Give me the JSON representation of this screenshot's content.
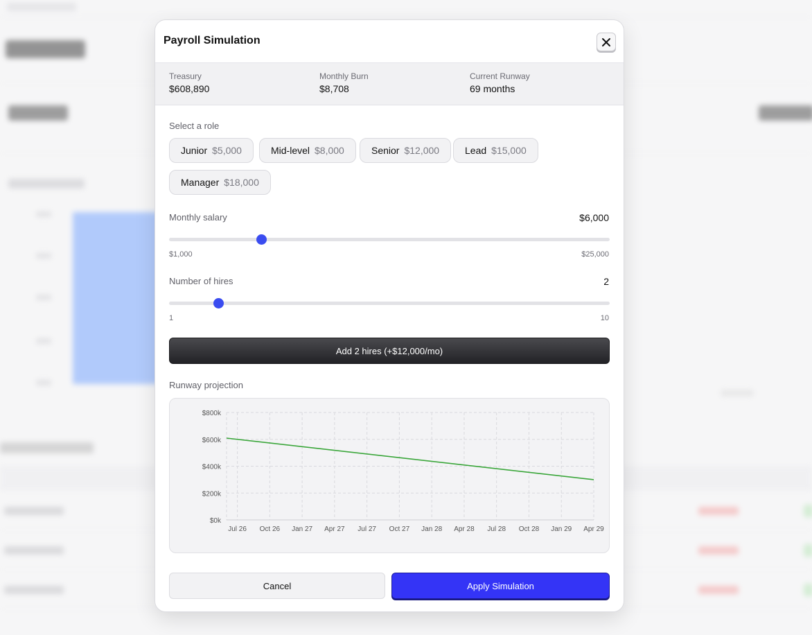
{
  "modal": {
    "title": "Payroll Simulation",
    "close_icon": "close-icon"
  },
  "summary": {
    "treasury_label": "Treasury",
    "treasury_value": "$608,890",
    "burn_label": "Monthly Burn",
    "burn_value": "$8,708",
    "runway_label": "Current Runway",
    "runway_value": "69 months"
  },
  "roles": {
    "label": "Select a role",
    "items": [
      {
        "name": "Junior",
        "salary": "$5,000"
      },
      {
        "name": "Mid-level",
        "salary": "$8,000"
      },
      {
        "name": "Senior",
        "salary": "$12,000"
      },
      {
        "name": "Lead",
        "salary": "$15,000"
      },
      {
        "name": "Manager",
        "salary": "$18,000"
      }
    ]
  },
  "salary": {
    "label": "Monthly salary",
    "value_text": "$6,000",
    "value": 6000,
    "min": 1000,
    "max": 25000,
    "min_label": "$1,000",
    "max_label": "$25,000"
  },
  "hires": {
    "label": "Number of hires",
    "value_text": "2",
    "value": 2,
    "min": 1,
    "max": 10,
    "min_label": "1",
    "max_label": "10"
  },
  "add_button": "Add 2 hires (+$12,000/mo)",
  "projection_label": "Runway projection",
  "chart_data": {
    "type": "line",
    "title": "",
    "xlabel": "",
    "ylabel": "",
    "ylim": [
      0,
      800000
    ],
    "yticks": [
      0,
      200000,
      400000,
      600000,
      800000
    ],
    "ytick_labels": [
      "$0k",
      "$200k",
      "$400k",
      "$600k",
      "$800k"
    ],
    "xtick_labels": [
      "Jul 26",
      "Oct 26",
      "Jan 27",
      "Apr 27",
      "Jul 27",
      "Oct 27",
      "Jan 28",
      "Apr 28",
      "Jul 28",
      "Oct 28",
      "Jan 29",
      "Apr 29"
    ],
    "x_range": [
      "Jun 26",
      "Apr 29"
    ],
    "series": [
      {
        "color": "#3aa63a",
        "x": [
          "Jun 26",
          "Apr 29"
        ],
        "values": [
          608890,
          300000
        ]
      }
    ],
    "grid": true,
    "grid_style": "dashed"
  },
  "footer": {
    "cancel": "Cancel",
    "apply": "Apply Simulation"
  },
  "colors": {
    "accent": "#3434f6",
    "slider": "#3a4cf0",
    "line": "#3aa63a"
  }
}
